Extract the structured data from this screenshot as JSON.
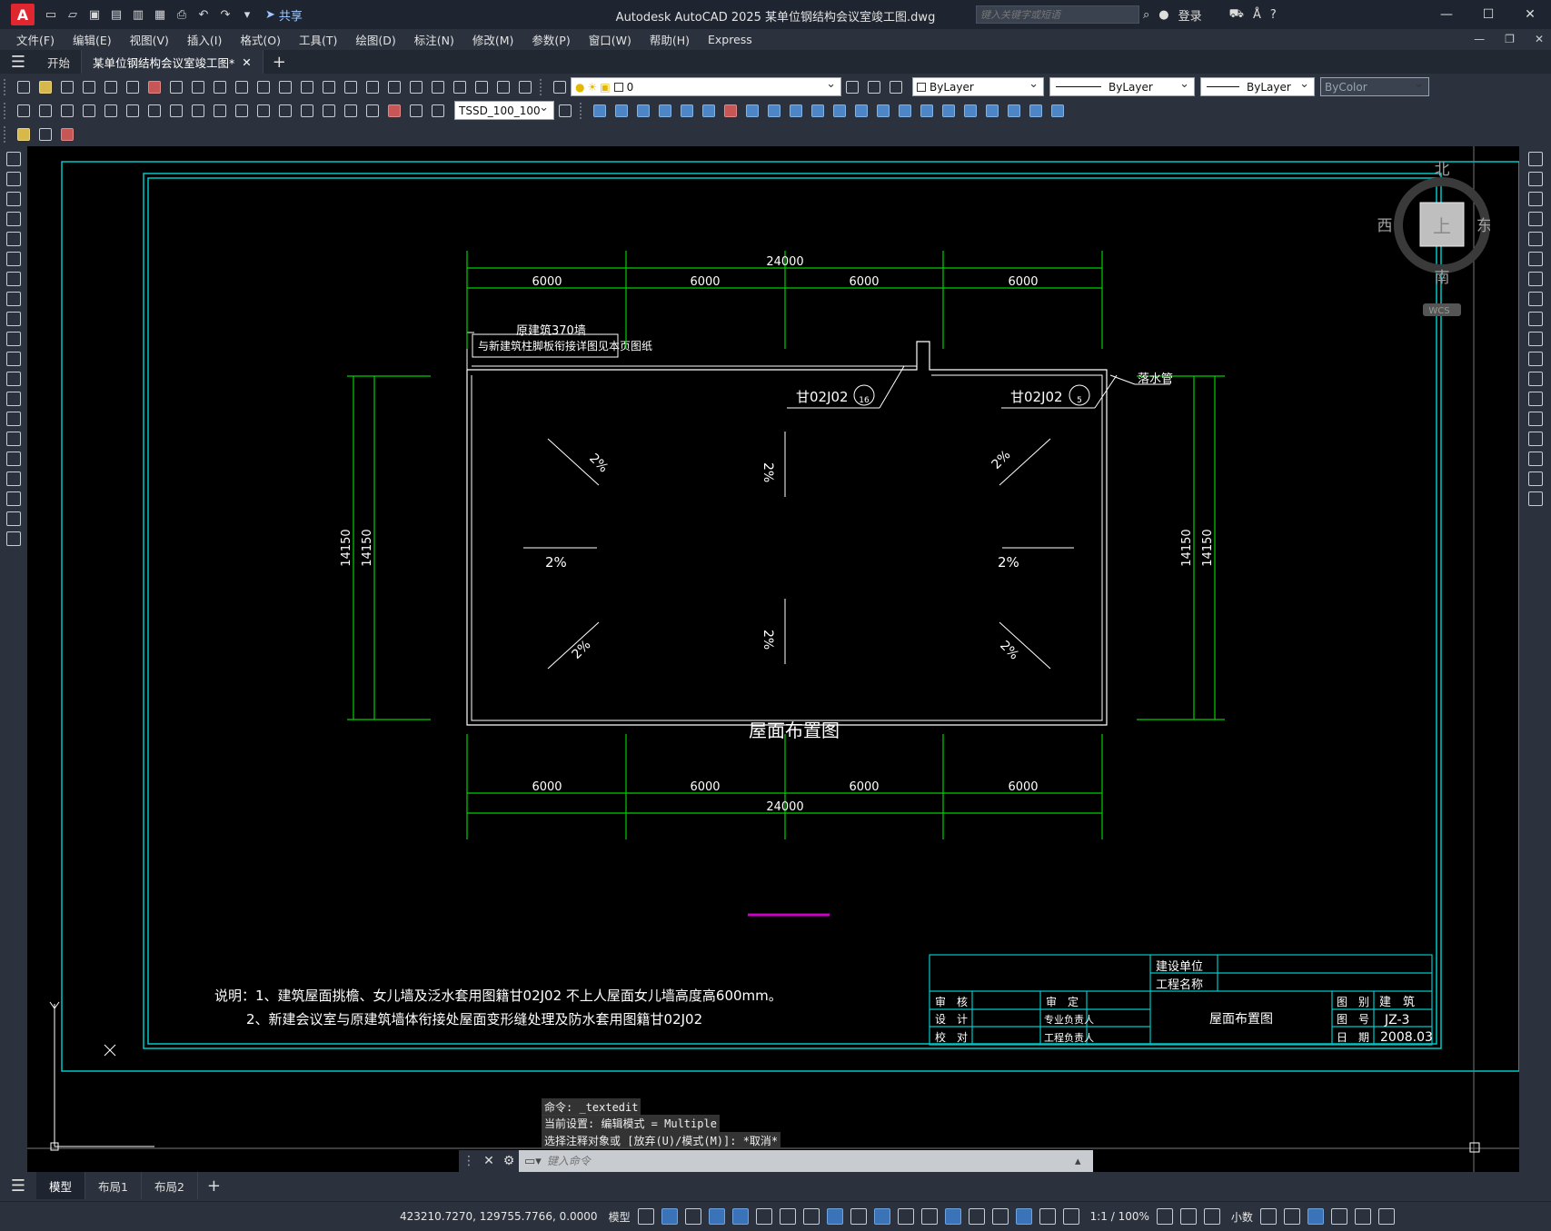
{
  "title_bar": {
    "app_icon_letter": "A",
    "share_label": "共享",
    "title": "Autodesk AutoCAD 2025    某单位钢结构会议室竣工图.dwg",
    "search_placeholder": "键入关键字或短语",
    "login_label": "登录"
  },
  "menu": [
    "文件(F)",
    "编辑(E)",
    "视图(V)",
    "插入(I)",
    "格式(O)",
    "工具(T)",
    "绘图(D)",
    "标注(N)",
    "修改(M)",
    "参数(P)",
    "窗口(W)",
    "帮助(H)",
    "Express"
  ],
  "doc_tabs": {
    "start": "开始",
    "current": "某单位钢结构会议室竣工图*"
  },
  "toolbar": {
    "layer_value": "0",
    "color_value": "ByLayer",
    "linetype_value": "ByLayer",
    "lineweight_value": "ByLayer",
    "plotstyle_value": "ByColor",
    "dimstyle_value": "TSSD_100_100"
  },
  "viewcube": {
    "north": "北",
    "south": "南",
    "east": "东",
    "west": "西",
    "top": "上",
    "wcs": "WCS"
  },
  "drawing": {
    "dim_total": "24000",
    "dim_bay": "6000",
    "dim_height": "14150",
    "wall_note_1": "原建筑370墙",
    "wall_note_2": "与新建筑柱脚板衔接详图见本页图纸",
    "detail_ref": "甘02J02",
    "detail_a_num": "16",
    "detail_b_num": "5",
    "downpipe": "落水管",
    "slope": "2%",
    "plan_title": "屋面布置图",
    "note_1": "说明：1、建筑屋面挑檐、女儿墙及泛水套用图籍甘02J02   不上人屋面女儿墙高度高600mm。",
    "note_2": "2、新建会议室与原建筑墙体衔接处屋面变形缝处理及防水套用图籍甘02J02"
  },
  "title_block": {
    "construction_unit": "建设单位",
    "project_name": "工程名称",
    "review": "审　核",
    "approve": "审　定",
    "design": "设　计",
    "specialty_lead": "专业负责人",
    "check": "校　对",
    "project_lead": "工程负责人",
    "drawing_title": "屋面布置图",
    "category_label": "图　别",
    "category_value": "建　筑",
    "number_label": "图　号",
    "number_value": "JZ-3",
    "date_label": "日　期",
    "date_value": "2008.03"
  },
  "command": {
    "hist_1": "命令: _textedit",
    "hist_2": "当前设置: 编辑模式 = Multiple",
    "hist_3": "选择注释对象或 [放弃(U)/模式(M)]: *取消*",
    "prompt": "键入命令"
  },
  "layout_tabs": [
    "模型",
    "布局1",
    "布局2"
  ],
  "status": {
    "coords": "423210.7270, 129755.7766, 0.0000",
    "model": "模型",
    "scale": "1:1 / 100%",
    "units": "小数"
  },
  "colors": {
    "accent_cyan": "#00c8c8",
    "dim_green": "#00d000",
    "ui_bg": "#2b323d"
  }
}
